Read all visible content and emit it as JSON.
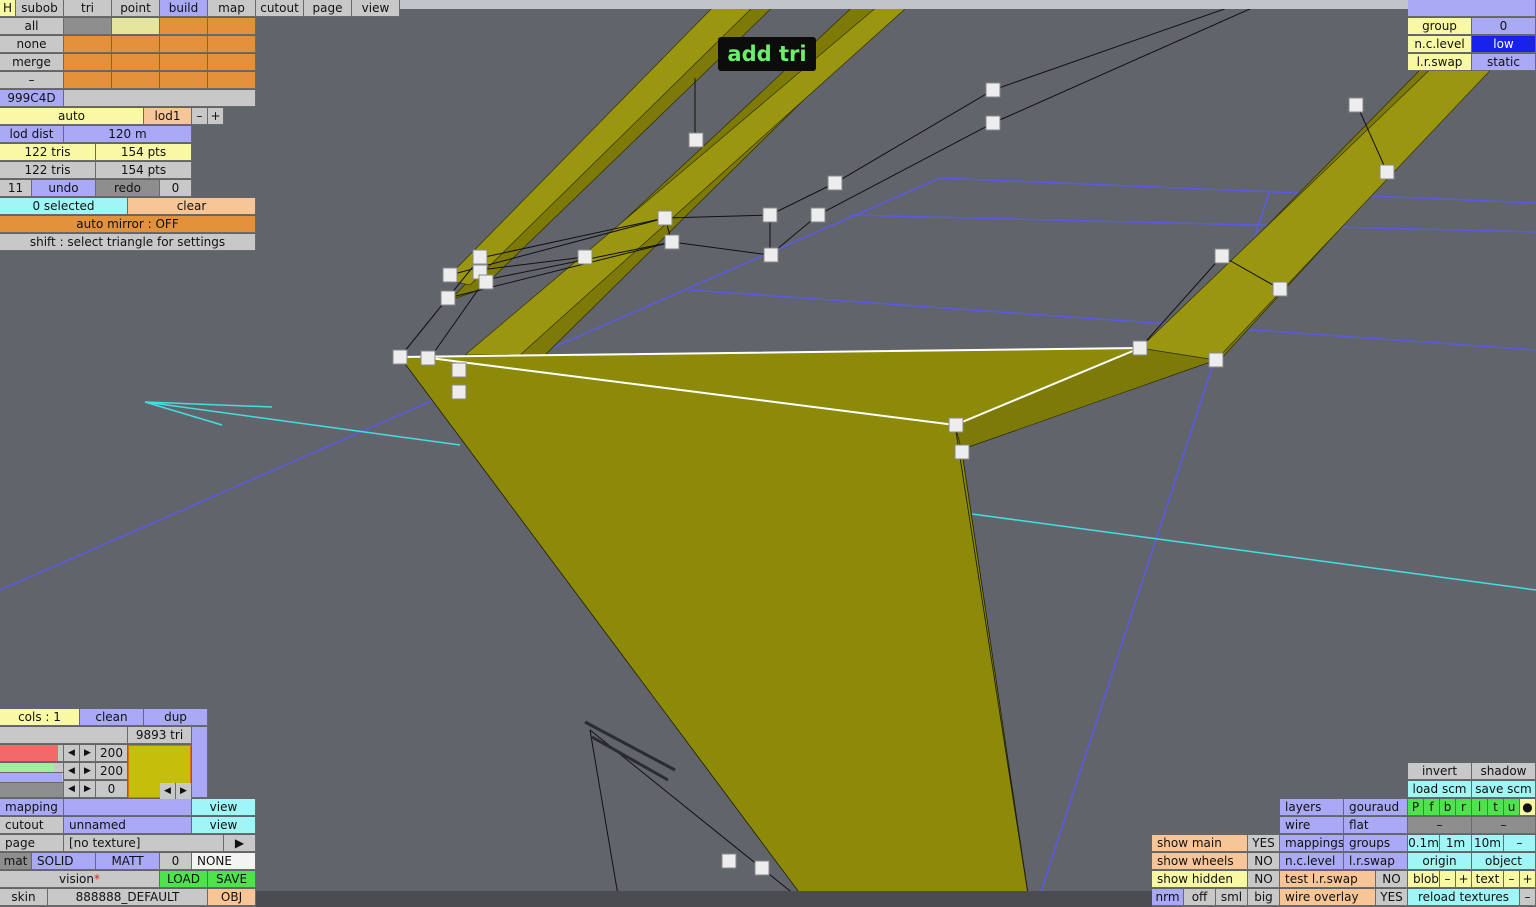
{
  "menu": {
    "h": "H",
    "subob": "subob",
    "tri": "tri",
    "point": "point",
    "build": "build",
    "map": "map",
    "cutout": "cutout",
    "page": "page",
    "view": "view"
  },
  "select_panel": {
    "all": "all",
    "none": "none",
    "merge": "merge",
    "dash": "–",
    "color_code": "999C4D",
    "auto": "auto",
    "lod": "lod1",
    "minus": "–",
    "plus": "+",
    "lod_dist_label": "lod dist",
    "lod_dist_value": "120 m",
    "tris_1": "122 tris",
    "pts_1": "154 pts",
    "tris_2": "122 tris",
    "pts_2": "154 pts",
    "undo_count": "11",
    "undo": "undo",
    "redo": "redo",
    "redo_count": "0",
    "selected": "0 selected",
    "clear": "clear",
    "auto_mirror": "auto mirror : OFF",
    "hint": "shift : select triangle for settings"
  },
  "tool_label": "add tri",
  "top_right": {
    "group_label": "group",
    "group_value": "0",
    "nclevel_label": "n.c.level",
    "nclevel_value": "low",
    "lrswap_label": "l.r.swap",
    "lrswap_value": "static"
  },
  "bottom_left": {
    "cols": "cols : 1",
    "clean": "clean",
    "dup": "dup",
    "tri_count": "9893 tri",
    "val_a": "200",
    "val_b": "200",
    "val_c": "0",
    "mapping": "mapping",
    "mapping_view": "view",
    "cutout": "cutout",
    "cutout_name": "unnamed",
    "cutout_view": "view",
    "page": "page",
    "texture": "[no texture]",
    "page_arrow": "▶",
    "mat": "mat",
    "solid": "SOLID",
    "matt": "MATT",
    "mat_zero": "0",
    "mat_none": "NONE",
    "vision": "vision",
    "vision_star": "*",
    "load": "LOAD",
    "save": "SAVE",
    "skin": "skin",
    "skin_name": "888888_DEFAULT",
    "obj": "OBJ"
  },
  "bottom_right": {
    "invert": "invert",
    "shadow": "shadow",
    "load_scm": "load scm",
    "save_scm": "save scm",
    "flags": [
      "P",
      "f",
      "b",
      "r",
      "l",
      "t",
      "u",
      "●"
    ],
    "layers": "layers",
    "gouraud": "gouraud",
    "wire": "wire",
    "flat": "flat",
    "dash1": "–",
    "dash2": "–",
    "show_main": "show main",
    "show_main_val": "YES",
    "mappings": "mappings",
    "groups": "groups",
    "s01": "0.1m",
    "s1": "1m",
    "s10": "10m",
    "sdash": "–",
    "show_wheels": "show wheels",
    "show_wheels_val": "NO",
    "nclevel": "n.c.level",
    "lrswap": "l.r.swap",
    "origin": "origin",
    "object": "object",
    "show_hidden": "show hidden",
    "show_hidden_val": "NO",
    "test_lrswap": "test l.r.swap",
    "test_lrswap_val": "NO",
    "blob": "blob",
    "blob_minus": "–",
    "blob_plus": "+",
    "text": "text",
    "text_minus": "–",
    "text_plus": "+",
    "nrm": "nrm",
    "off": "off",
    "sml": "sml",
    "big": "big",
    "wire_overlay": "wire overlay",
    "wire_overlay_val": "YES",
    "reload_textures": "reload textures",
    "reload_dash": "–"
  }
}
